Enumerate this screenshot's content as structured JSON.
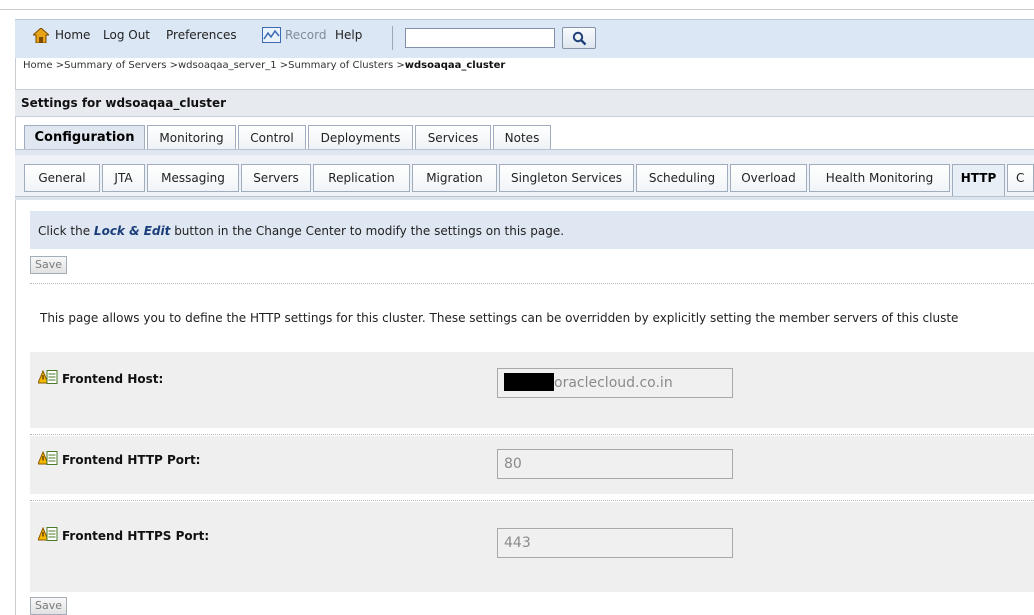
{
  "toolbar": {
    "home": "Home",
    "logout": "Log Out",
    "preferences": "Preferences",
    "record": "Record",
    "help": "Help",
    "search_value": ""
  },
  "breadcrumb": {
    "items": [
      "Home >",
      "Summary of Servers >",
      "wdsoaqaa_server_1 >",
      "Summary of Clusters >"
    ],
    "current": "wdsoaqaa_cluster"
  },
  "settings_title": "Settings for wdsoaqaa_cluster",
  "main_tabs": [
    "Configuration",
    "Monitoring",
    "Control",
    "Deployments",
    "Services",
    "Notes"
  ],
  "sub_tabs": [
    "General",
    "JTA",
    "Messaging",
    "Servers",
    "Replication",
    "Migration",
    "Singleton Services",
    "Scheduling",
    "Overload",
    "Health Monitoring",
    "HTTP",
    "C"
  ],
  "lock_message": {
    "prefix": "Click the ",
    "link": "Lock & Edit",
    "suffix": " button in the Change Center to modify the settings on this page."
  },
  "save_label": "Save",
  "description": "This page allows you to define the HTTP settings for this cluster. These settings can be overridden by explicitly setting the member servers of this cluste",
  "fields": {
    "frontend_host": {
      "label": "Frontend Host:",
      "value": "oraclecloud.co.in"
    },
    "frontend_http_port": {
      "label": "Frontend HTTP Port:",
      "value": "80"
    },
    "frontend_https_port": {
      "label": "Frontend HTTPS Port:",
      "value": "443"
    }
  },
  "colors": {
    "toolbar_bg": "#dce7f5",
    "info_bg": "#dfe7f2",
    "row_bg": "#efefef",
    "link_blue": "#1a3d7a"
  }
}
